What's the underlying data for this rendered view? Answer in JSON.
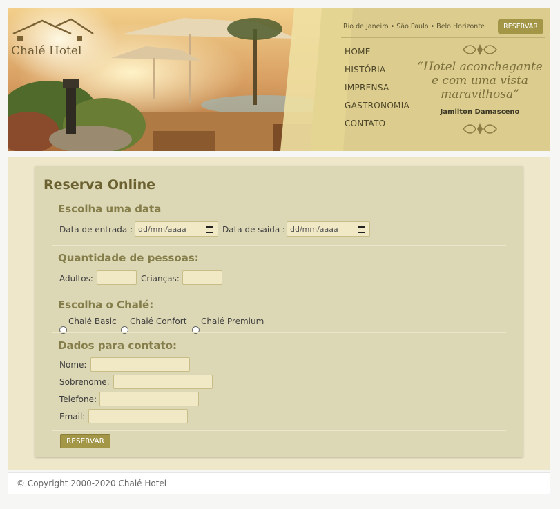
{
  "header": {
    "logo_text": "Chalé Hotel",
    "cities": "Rio de Janeiro • São Paulo • Belo Horizonte",
    "reserve_button": "RESERVAR",
    "nav": [
      "HOME",
      "HISTÓRIA",
      "IMPRENSA",
      "GASTRONOMIA",
      "CONTATO"
    ],
    "quote": "“Hotel aconchegante e com uma vista maravilhosa”",
    "author": "Jamilton Damasceno"
  },
  "form": {
    "title": "Reserva Online",
    "date_section": "Escolha uma data",
    "checkin_label": "Data de entrada :",
    "checkin_placeholder": "dd/mm/aaaa",
    "checkout_label": "Data de saida :",
    "checkout_placeholder": "dd/mm/aaaa",
    "people_section": "Quantidade de pessoas:",
    "adults_label": "Adultos:",
    "children_label": "Crianças:",
    "chalet_section": "Escolha o Chalé:",
    "chalet_options": [
      "Chalé Basic",
      "Chalé Confort",
      "Chalé Premium"
    ],
    "contact_section": "Dados para contato:",
    "name_label": "Nome:",
    "surname_label": "Sobrenome:",
    "phone_label": "Telefone:",
    "email_label": "Email:",
    "submit": "RESERVAR"
  },
  "footer": {
    "copyright": "© Copyright 2000-2020 Chalé Hotel"
  },
  "colors": {
    "accent": "#a39647",
    "panel": "#dcd7b5",
    "input": "#f1e8c6",
    "heading": "#6b6130"
  }
}
